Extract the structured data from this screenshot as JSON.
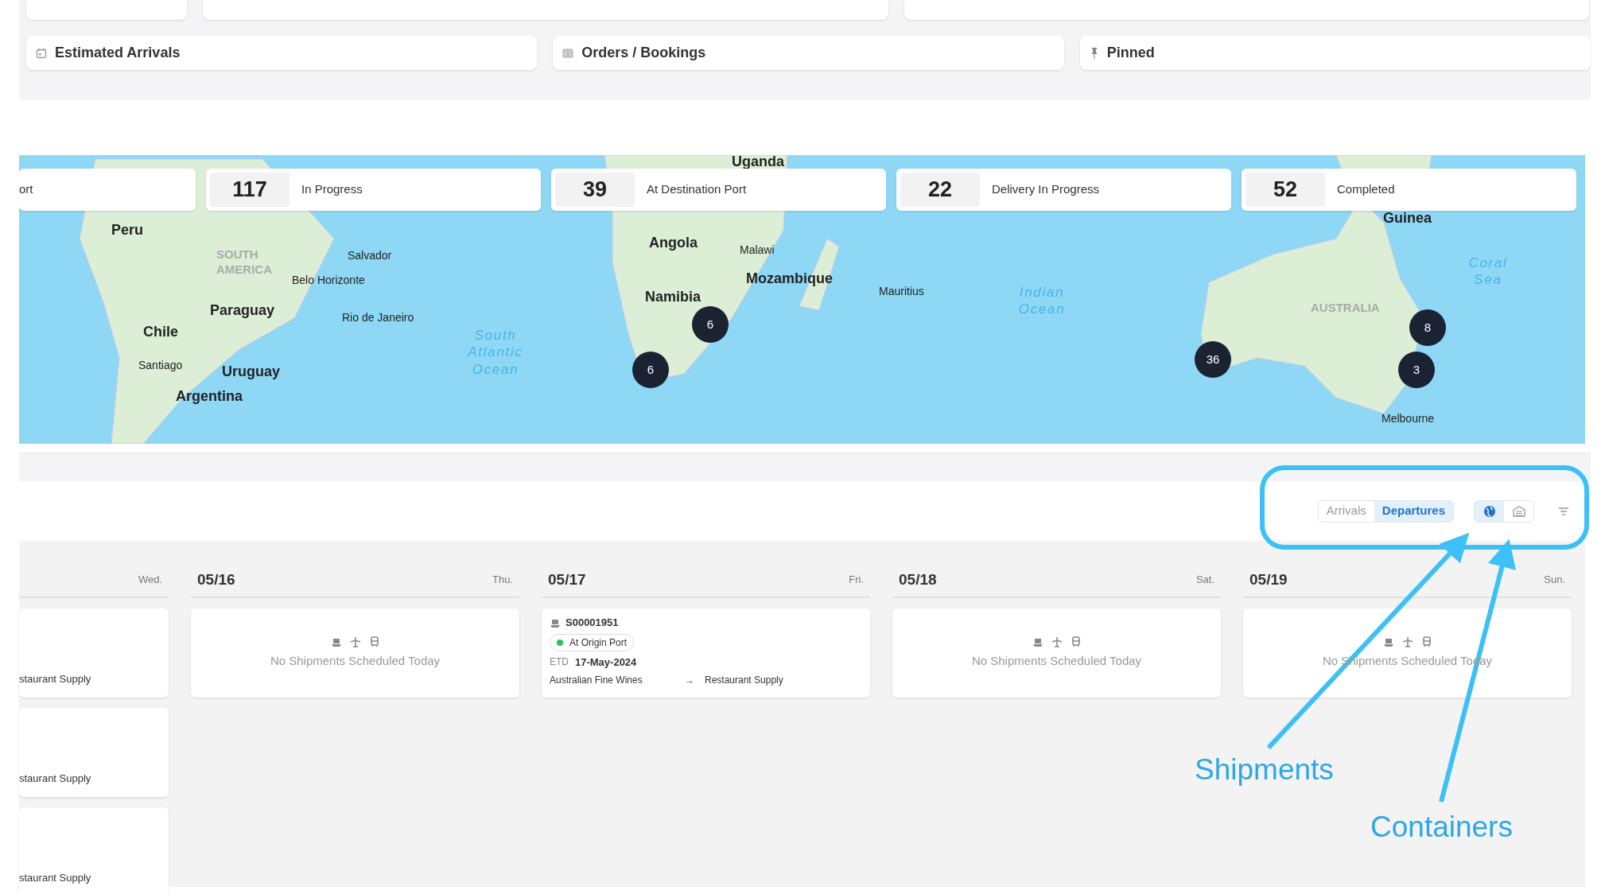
{
  "quick_links": [
    {
      "label": "Estimated Arrivals"
    },
    {
      "label": "Orders / Bookings"
    },
    {
      "label": "Pinned"
    }
  ],
  "map": {
    "stats": [
      {
        "label": "ort"
      },
      {
        "count": "117",
        "label": "In Progress"
      },
      {
        "count": "39",
        "label": "At Destination Port"
      },
      {
        "count": "22",
        "label": "Delivery In Progress"
      },
      {
        "count": "52",
        "label": "Completed"
      }
    ],
    "labels": [
      {
        "text": "Uganda",
        "kind": "country"
      },
      {
        "text": "Peru",
        "kind": "country"
      },
      {
        "text": "SOUTH AMERICA",
        "kind": "region"
      },
      {
        "text": "Salvador",
        "kind": "city"
      },
      {
        "text": "Belo Horizonte",
        "kind": "city"
      },
      {
        "text": "Paraguay",
        "kind": "country"
      },
      {
        "text": "Rio de Janeiro",
        "kind": "city"
      },
      {
        "text": "Chile",
        "kind": "country"
      },
      {
        "text": "Santiago",
        "kind": "city"
      },
      {
        "text": "Uruguay",
        "kind": "country"
      },
      {
        "text": "Argentina",
        "kind": "country"
      },
      {
        "text": "South Atlantic Ocean",
        "kind": "ocean"
      },
      {
        "text": "Angola",
        "kind": "country"
      },
      {
        "text": "Malawi",
        "kind": "city"
      },
      {
        "text": "Mozambique",
        "kind": "country"
      },
      {
        "text": "Namibia",
        "kind": "country"
      },
      {
        "text": "Mauritius",
        "kind": "city"
      },
      {
        "text": "Indian Ocean",
        "kind": "ocean"
      },
      {
        "text": "Guinea",
        "kind": "country"
      },
      {
        "text": "AUSTRALIA",
        "kind": "region"
      },
      {
        "text": "Coral Sea",
        "kind": "ocean"
      },
      {
        "text": "Melbourne",
        "kind": "city"
      }
    ],
    "clusters": [
      "6",
      "6",
      "36",
      "8",
      "3"
    ]
  },
  "toolbar": {
    "direction": [
      {
        "label": "Arrivals",
        "selected": false
      },
      {
        "label": "Departures",
        "selected": true
      }
    ],
    "view": [
      {
        "kind": "globe",
        "selected": true
      },
      {
        "kind": "container",
        "selected": false
      }
    ]
  },
  "calendar": {
    "days": [
      {
        "weekday": "Wed.",
        "entries": [
          {
            "kind": "partial",
            "to": "staurant Supply"
          },
          {
            "kind": "partial",
            "to": "staurant Supply"
          },
          {
            "kind": "partial",
            "to": "staurant Supply"
          }
        ]
      },
      {
        "date": "05/16",
        "weekday": "Thu.",
        "empty_text": "No Shipments Scheduled Today"
      },
      {
        "date": "05/17",
        "weekday": "Fri.",
        "entries": [
          {
            "kind": "shipment",
            "id": "S00001951",
            "status": "At Origin Port",
            "etd_label": "ETD",
            "etd": "17-May-2024",
            "from": "Australian Fine Wines",
            "arrow": "→",
            "to": "Restaurant Supply"
          }
        ]
      },
      {
        "date": "05/18",
        "weekday": "Sat.",
        "empty_text": "No Shipments Scheduled Today"
      },
      {
        "date": "05/19",
        "weekday": "Sun.",
        "empty_text": "No Shipments Scheduled Today"
      }
    ]
  },
  "annotations": [
    {
      "label": "Shipments"
    },
    {
      "label": "Containers"
    }
  ]
}
